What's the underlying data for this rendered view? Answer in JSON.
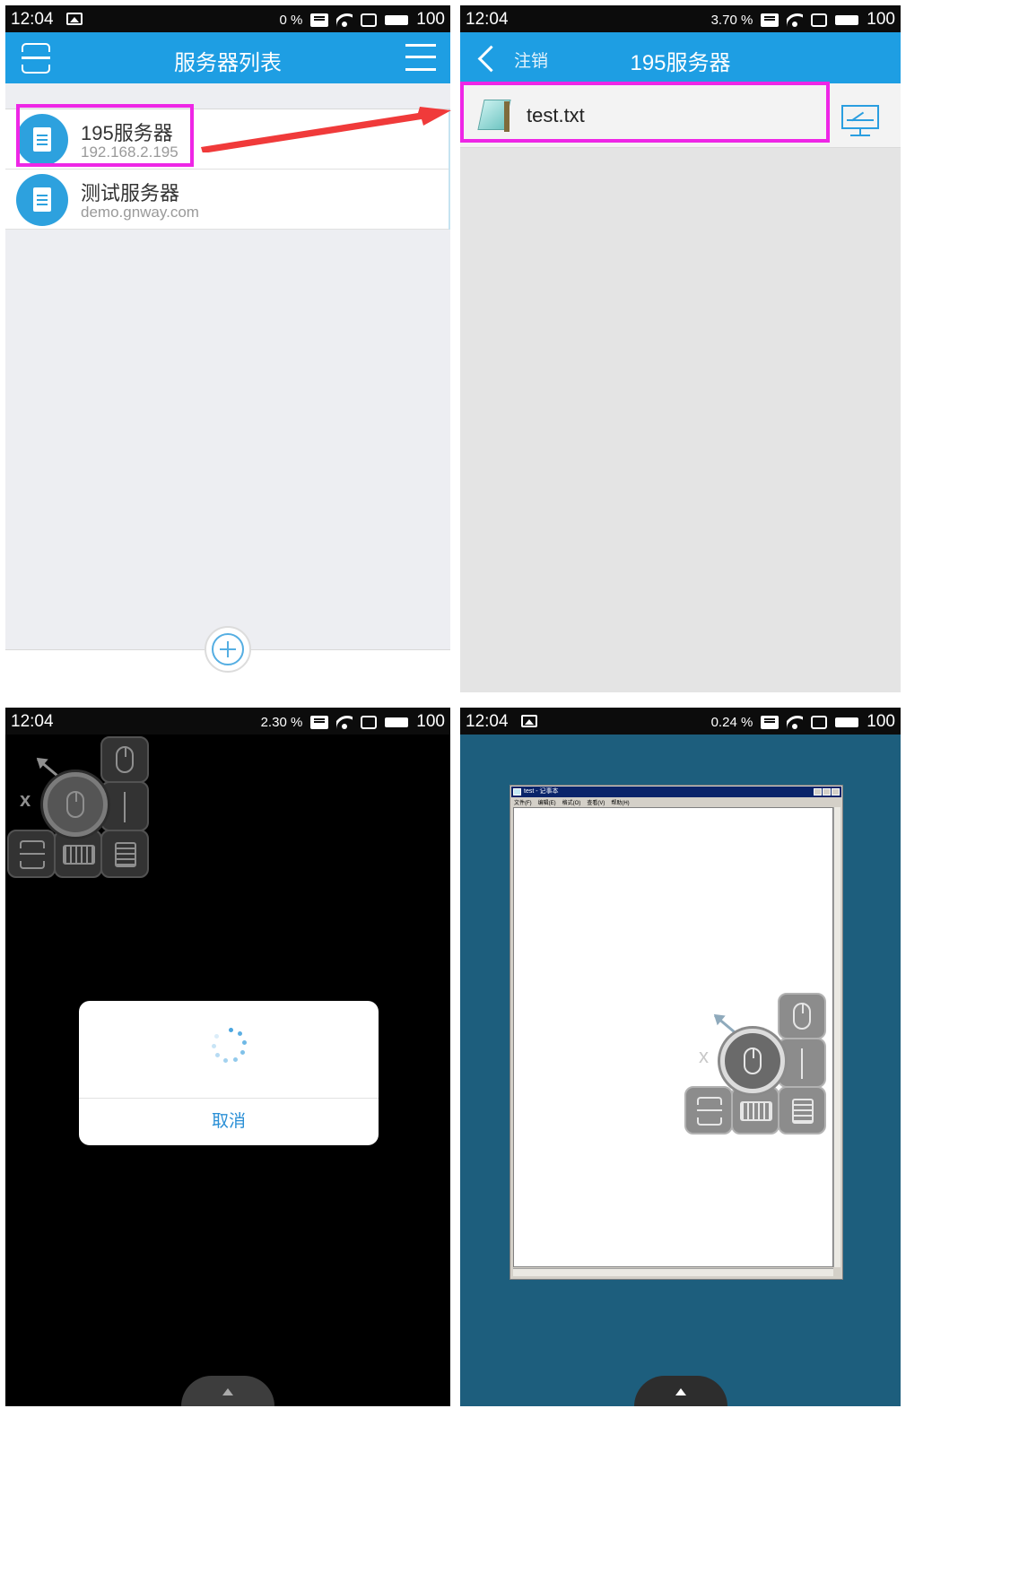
{
  "colors": {
    "appbar": "#1e9ee3",
    "highlight": "#ee26e6",
    "arrow": "#f03a3a",
    "desktop": "#1d5e7d",
    "accent": "#2a8fd6"
  },
  "panel1": {
    "status": {
      "time": "12:04",
      "speed": "0 %",
      "battery": "100"
    },
    "title": "服务器列表",
    "servers": [
      {
        "name": "195服务器",
        "host": "192.168.2.195"
      },
      {
        "name": "测试服务器",
        "host": "demo.gnway.com"
      }
    ],
    "icons": {
      "left": "menu-icon",
      "right": "hamburger-icon",
      "fab": "add-icon"
    }
  },
  "panel2": {
    "status": {
      "time": "12:04",
      "speed": "3.70 %",
      "battery": "100"
    },
    "back_label": "注销",
    "title": "195服务器",
    "file": {
      "name": "test.txt",
      "icon": "notepad-icon"
    },
    "action_icon": "remote-desktop-icon"
  },
  "panel3": {
    "status": {
      "time": "12:04",
      "speed": "2.30 %",
      "battery": "100"
    },
    "close_label": "x",
    "dialog": {
      "cancel_label": "取消"
    }
  },
  "panel4": {
    "status": {
      "time": "12:04",
      "speed": "0.24 %",
      "battery": "100"
    },
    "notepad": {
      "title": "test - 记事本",
      "menu": [
        "文件(F)",
        "编辑(E)",
        "格式(O)",
        "查看(V)",
        "帮助(H)"
      ]
    },
    "close_label": "x"
  }
}
